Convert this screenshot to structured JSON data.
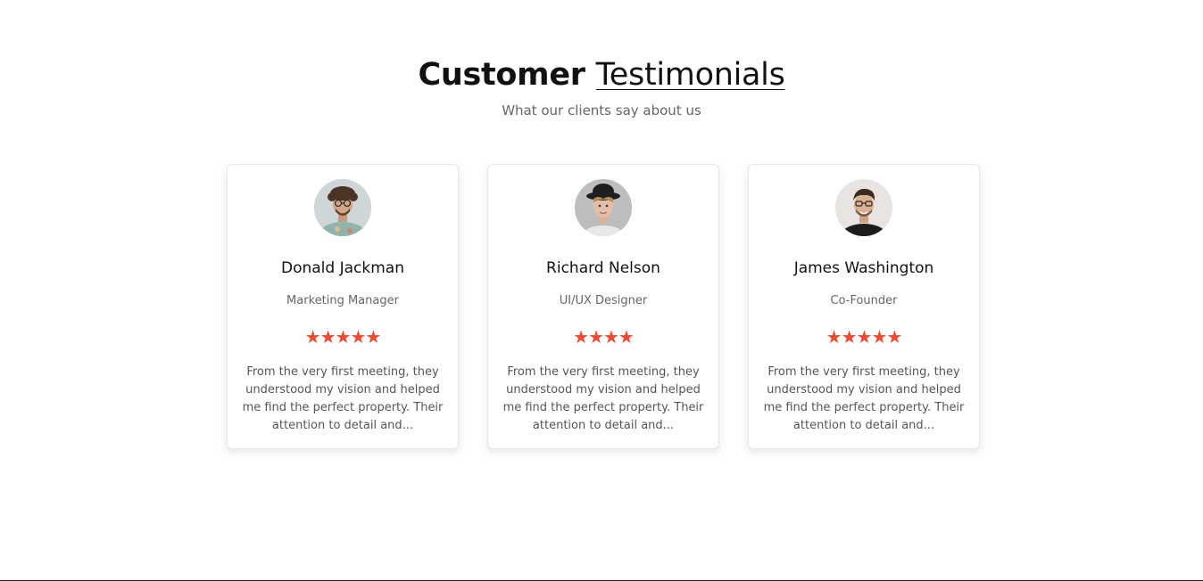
{
  "header": {
    "title_bold": "Customer",
    "title_light": "Testimonials",
    "subtitle": "What our clients say about us"
  },
  "colors": {
    "star": "#ef4b32",
    "muted_text": "#666666"
  },
  "testimonials": [
    {
      "name": "Donald Jackman",
      "role": "Marketing Manager",
      "rating": 5,
      "stars": "★★★★★",
      "text": "From the very first meeting, they understood my vision and helped me find the perfect property. Their attention to detail and...",
      "avatar_icon": "avatar-photo-curly-hair-glasses"
    },
    {
      "name": "Richard Nelson",
      "role": "UI/UX Designer",
      "rating": 4,
      "stars": "★★★★",
      "text": "From the very first meeting, they understood my vision and helped me find the perfect property. Their attention to detail and...",
      "avatar_icon": "avatar-photo-hat"
    },
    {
      "name": "James Washington",
      "role": "Co-Founder",
      "rating": 5,
      "stars": "★★★★★",
      "text": "From the very first meeting, they understood my vision and helped me find the perfect property. Their attention to detail and...",
      "avatar_icon": "avatar-photo-glasses-black-shirt"
    }
  ]
}
